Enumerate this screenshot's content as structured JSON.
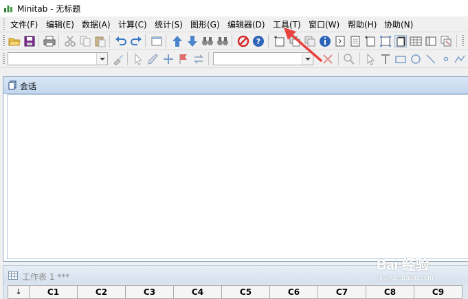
{
  "window": {
    "title": "Minitab - 无标题"
  },
  "menu": {
    "items": [
      "文件(F)",
      "编辑(E)",
      "数据(A)",
      "计算(C)",
      "统计(S)",
      "图形(G)",
      "编辑器(D)",
      "工具(T)",
      "窗口(W)",
      "帮助(H)",
      "协助(N)"
    ]
  },
  "toolbar1": {
    "icons": [
      "open-icon",
      "save-icon",
      "print-icon",
      "cut-icon",
      "copy-icon",
      "paste-icon",
      "undo-icon",
      "redo-icon",
      "window-icon",
      "arrow-up-icon",
      "arrow-down-icon",
      "binoculars-icon",
      "binoculars-next-icon",
      "stop-icon",
      "help-icon",
      "new-graph-icon",
      "graph-copy-icon",
      "graph-stack-icon",
      "info-icon",
      "session-icon",
      "notepad-icon",
      "worksheet-new-icon",
      "layout-icon",
      "session-window-icon",
      "table-icon",
      "panel-icon",
      "overlay-icon"
    ]
  },
  "toolbar2": {
    "combo1_value": "",
    "combo2_value": ""
  },
  "session": {
    "title": "会话"
  },
  "worksheet": {
    "title": "工作表 1 ***",
    "row_header": "↓",
    "columns": [
      "C1",
      "C2",
      "C3",
      "C4",
      "C5",
      "C6",
      "C7",
      "C8",
      "C9"
    ]
  },
  "watermark": {
    "brand": "Bai 经验",
    "url": "jingyan.baidu.com"
  },
  "colors": {
    "accent": "#e8433f",
    "session_title": "#c3d7ee"
  }
}
